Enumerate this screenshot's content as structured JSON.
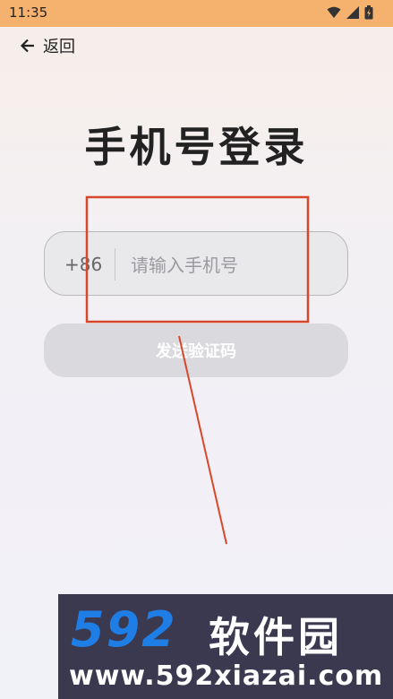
{
  "status_bar": {
    "time": "11:35"
  },
  "nav": {
    "back_label": "返回"
  },
  "login": {
    "title": "手机号登录",
    "country_code": "+86",
    "phone_placeholder": "请输入手机号",
    "send_code_label": "发送验证码"
  },
  "watermark": {
    "brand_number": "592",
    "brand_name": "软件园",
    "url": "www.592xiazai.com"
  },
  "colors": {
    "status_bar": "#f5b16e",
    "annotation": "#d9472b",
    "button_disabled": "#d9d9de"
  }
}
